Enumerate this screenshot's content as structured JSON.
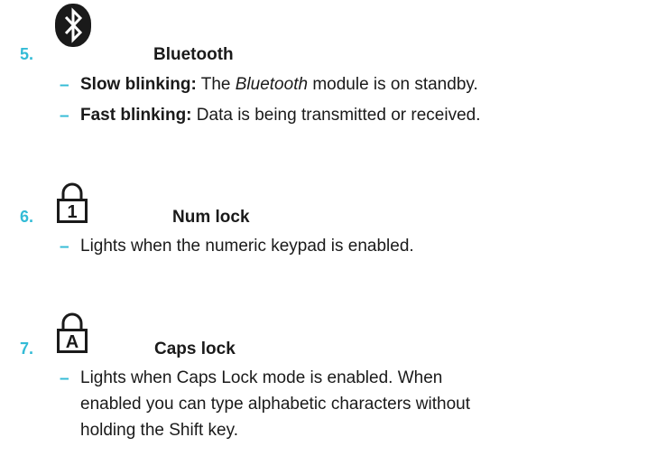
{
  "accent_color": "#33bbd6",
  "items": [
    {
      "number": "5.",
      "icon": "bluetooth-icon",
      "title": "Bluetooth",
      "bullets": [
        {
          "bold": "Slow blinking:",
          "text_before": "The",
          "italic": "Bluetooth",
          "text_after": "module is on standby."
        },
        {
          "bold": "Fast blinking:",
          "text": "Data is being transmitted or received."
        }
      ]
    },
    {
      "number": "6.",
      "icon": "num-lock-icon",
      "icon_glyph": "1",
      "title": "Num lock",
      "bullets": [
        {
          "text": "Lights when the numeric keypad is enabled."
        }
      ]
    },
    {
      "number": "7.",
      "icon": "caps-lock-icon",
      "icon_glyph": "A",
      "title": "Caps lock",
      "bullets": [
        {
          "lines": [
            "Lights when Caps Lock mode is enabled. When",
            "enabled you can type alphabetic characters without",
            "holding the Shift key."
          ]
        }
      ]
    }
  ]
}
